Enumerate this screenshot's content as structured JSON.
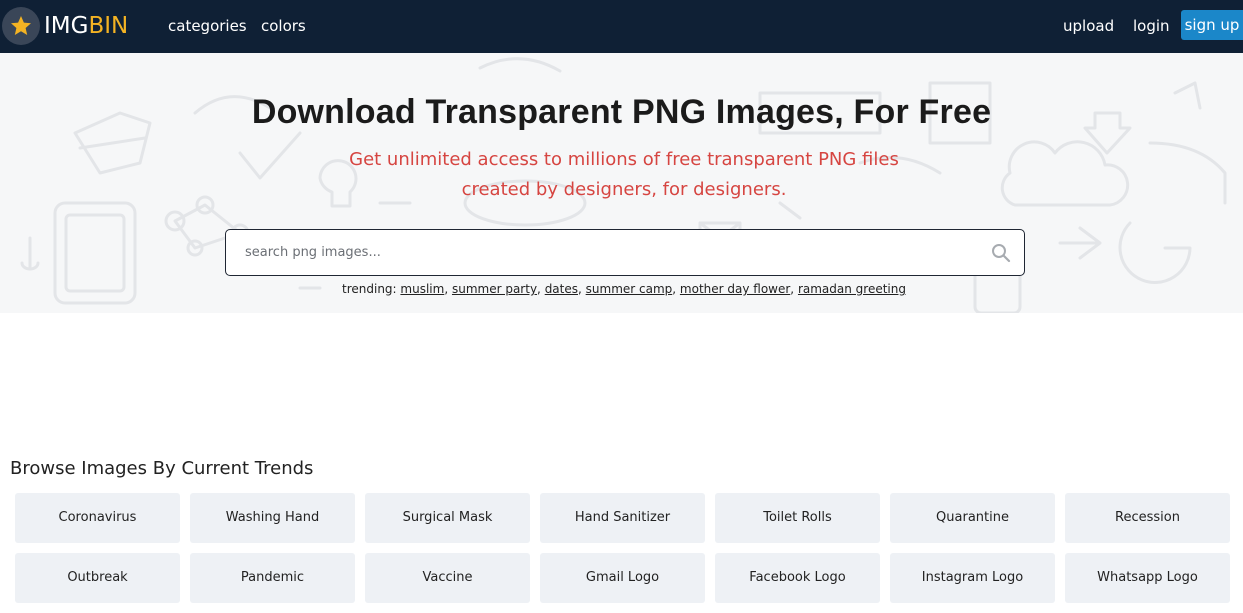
{
  "nav": {
    "logo_img": "IMG",
    "logo_bin": "BIN",
    "categories": "categories",
    "colors": "colors",
    "upload": "upload",
    "login": "login",
    "signup": "sign up"
  },
  "hero": {
    "title": "Download Transparent PNG Images, For Free",
    "subtitle_line1": "Get unlimited access to millions of free transparent PNG files",
    "subtitle_line2": "created by designers, for designers.",
    "search_placeholder": "search png images...",
    "trending_label": "trending:",
    "trending": [
      "muslim",
      "summer party",
      "dates",
      "summer camp",
      "mother day flower",
      "ramadan greeting"
    ]
  },
  "trends": {
    "title": "Browse Images By Current Trends",
    "items": [
      "Coronavirus",
      "Washing Hand",
      "Surgical Mask",
      "Hand Sanitizer",
      "Toilet Rolls",
      "Quarantine",
      "Recession",
      "Outbreak",
      "Pandemic",
      "Vaccine",
      "Gmail Logo",
      "Facebook Logo",
      "Instagram Logo",
      "Whatsapp Logo"
    ]
  },
  "icons": {
    "logo": "star-icon",
    "search": "search-icon"
  },
  "colors": {
    "navbar": "#0f2035",
    "accent": "#f4b323",
    "signup": "#1b87c9",
    "subtitle": "#d64541"
  }
}
